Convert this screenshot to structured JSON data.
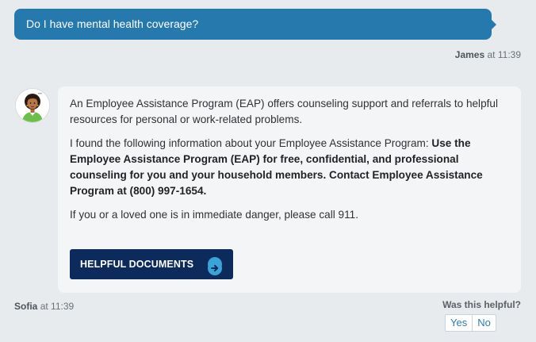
{
  "user_message": {
    "text": "Do I have mental health coverage?",
    "sender": "James",
    "at_word": "at",
    "time": "11:39"
  },
  "bot_message": {
    "paragraph1": "An Employee Assistance Program (EAP) offers counseling support and referrals to helpful resources for personal or work-related problems.",
    "paragraph2_intro": "I found the following information about your Employee Assistance Program: ",
    "paragraph2_bold": "Use the Employee Assistance Program (EAP) for free, confidential, and professional counseling for you and your household members. Contact Employee Assistance Program at (800) 997-1654.",
    "paragraph3": "If you or a loved one is in immediate danger, please call 911.",
    "documents_button": "HELPFUL DOCUMENTS",
    "sender": "Sofia",
    "at_word": "at",
    "time": "11:39"
  },
  "feedback": {
    "question": "Was this helpful?",
    "yes": "Yes",
    "no": "No"
  },
  "colors": {
    "user_bubble": "#2679ad",
    "documents_button": "#0c2a5c",
    "arrow_circle": "#3aa3d7",
    "background": "#e8ebee"
  },
  "icons": {
    "avatar": "assistant-avatar-icon",
    "button_arrow": "arrow-right-circle-icon"
  }
}
